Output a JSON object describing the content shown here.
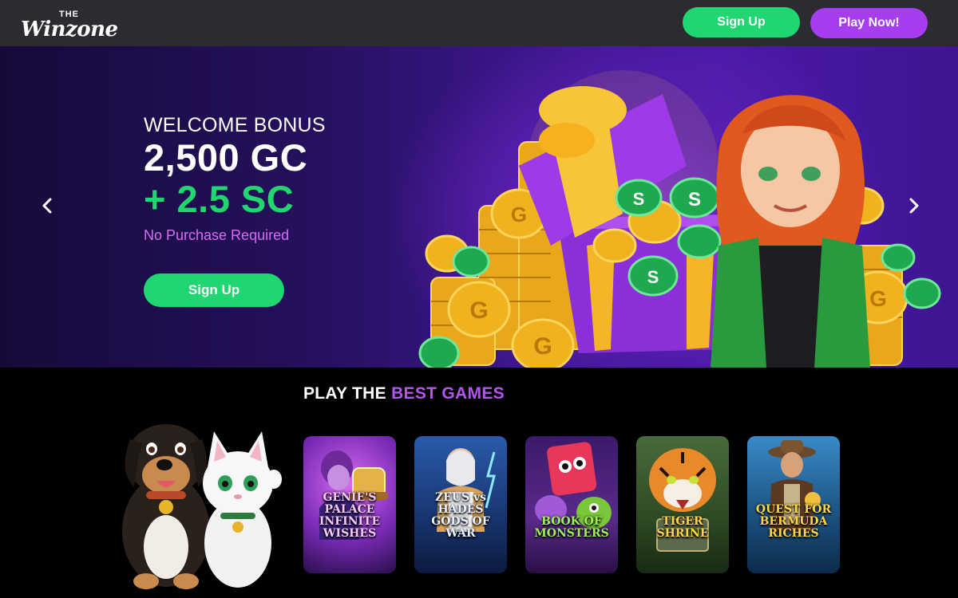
{
  "header": {
    "logo_the": "THE",
    "logo_main": "Winzone",
    "signup_label": "Sign Up",
    "play_label": "Play Now!"
  },
  "hero": {
    "welcome": "WELCOME BONUS",
    "gc": "2,500 GC",
    "sc": "+ 2.5 SC",
    "no_purchase": "No Purchase Required",
    "signup_label": "Sign Up",
    "prev_icon": "chevron-left-icon",
    "next_icon": "chevron-right-icon"
  },
  "games": {
    "title_a": "PLAY THE ",
    "title_b": "BEST GAMES",
    "cards": [
      {
        "name": "GENIE'S PALACE INFINITE WISHES"
      },
      {
        "name": "ZEUS vs HADES GODS OF WAR"
      },
      {
        "name": "BOOK OF MONSTERS"
      },
      {
        "name": "TIGER SHRINE"
      },
      {
        "name": "QUEST FOR BERMUDA RICHES"
      }
    ]
  },
  "colors": {
    "green": "#1fd670",
    "purple": "#a63df0",
    "pink_text": "#d86cf0",
    "header_bg": "#2b2b30"
  }
}
